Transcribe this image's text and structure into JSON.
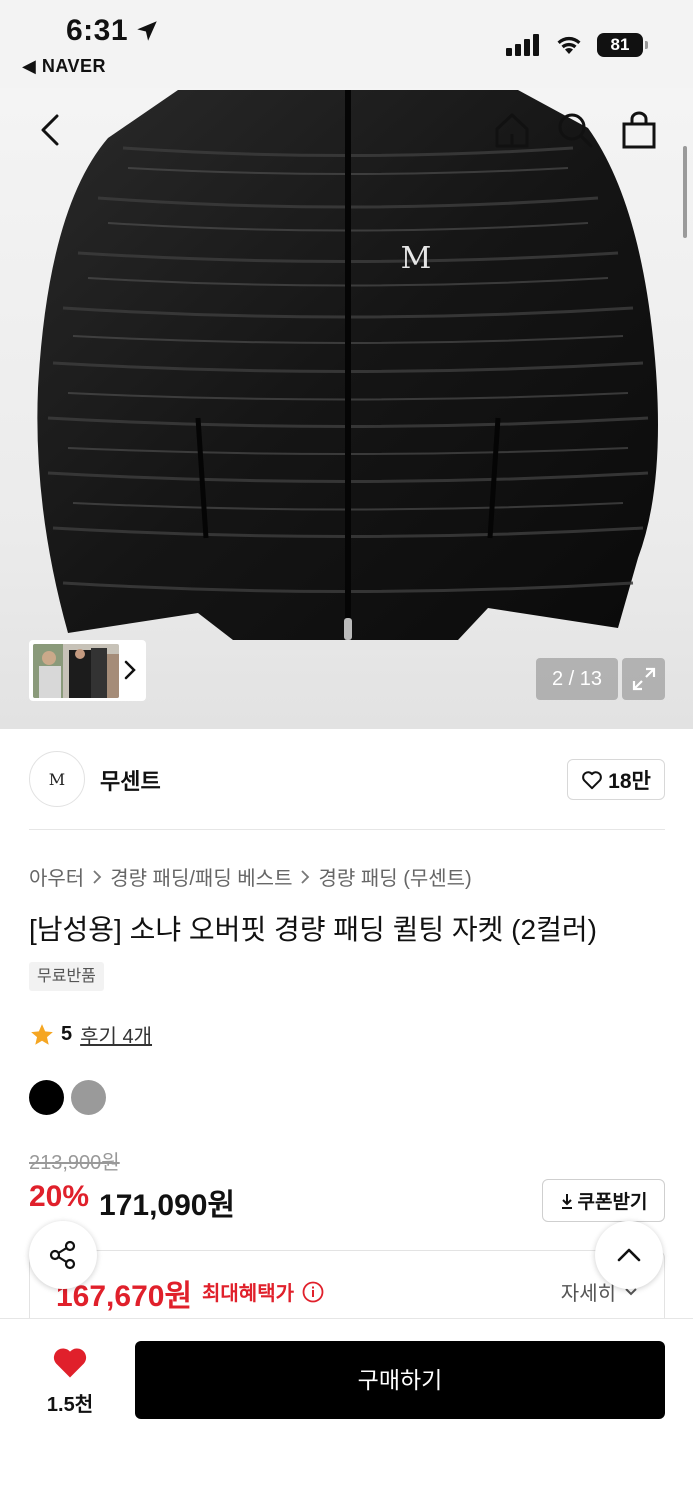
{
  "status_bar": {
    "time": "6:31",
    "back_app": "◀ NAVER",
    "battery": "81"
  },
  "header": {
    "back_icon": "chevron-left-icon",
    "home_icon": "home-icon",
    "search_icon": "search-icon",
    "bag_icon": "shopping-bag-icon"
  },
  "gallery": {
    "counter": "2 / 13",
    "expand_icon": "expand-icon",
    "logo_text": "M"
  },
  "store": {
    "logo_text": "M",
    "name": "무센트",
    "likes": "18만"
  },
  "breadcrumbs": [
    "아우터",
    "경량 패딩/패딩 베스트",
    "경량 패딩 (무센트)"
  ],
  "product": {
    "title": "[남성용] 소냐 오버핏 경량 패딩 퀼팅 자켓 (2컬러)",
    "badge": "무료반품",
    "rating": "5",
    "reviews": "후기 4개",
    "colors": [
      "#000000",
      "#9a9a9a"
    ]
  },
  "price": {
    "original": "213,900원",
    "discount": "20%",
    "sale": "171,090원",
    "coupon_label": "쿠폰받기",
    "benefit_price": "167,670원",
    "benefit_label": "최대혜택가",
    "more_label": "자세히"
  },
  "bottom_bar": {
    "wish_count": "1.5천",
    "buy_label": "구매하기"
  },
  "colors": {
    "accent_red": "#e0202b",
    "buy_button": "#000000"
  }
}
